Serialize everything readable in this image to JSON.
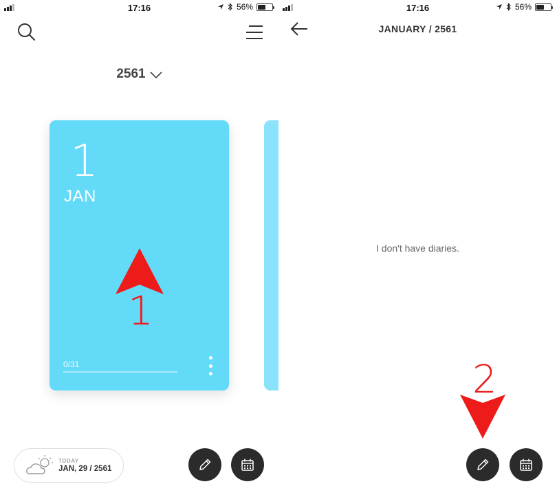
{
  "status_bar": {
    "time": "17:16",
    "battery_percent": "56%",
    "battery_level": 0.56
  },
  "left_screen": {
    "year_selector": {
      "year": "2561"
    },
    "month_card": {
      "day": "1",
      "month": "JAN",
      "progress_text": "0/31",
      "progress_fraction": 0,
      "color": "#63daf8"
    },
    "today_chip": {
      "label": "TODAY",
      "date": "JAN, 29 / 2561",
      "weather_icon": "partly-cloudy-icon"
    },
    "annotation": {
      "number": "1",
      "color": "#ee1b1b"
    }
  },
  "right_screen": {
    "title": "JANUARY / 2561",
    "empty_message": "I don't have diaries.",
    "annotation": {
      "number": "2",
      "color": "#ee1b1b"
    }
  },
  "icons": {
    "search": "search-icon",
    "menu": "menu-icon",
    "back": "back-arrow-icon",
    "write": "pencil-icon",
    "calendar": "calendar-icon",
    "chevron": "chevron-down-icon"
  },
  "colors": {
    "fab": "#2b2b2b",
    "card": "#63daf8"
  }
}
